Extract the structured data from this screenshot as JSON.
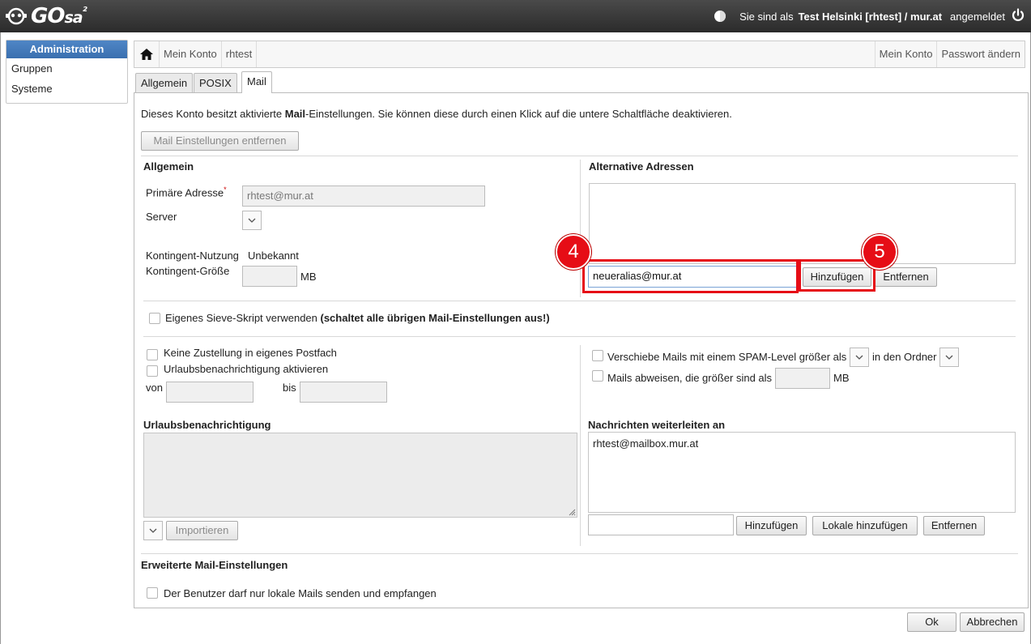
{
  "header": {
    "logo_text": "GO",
    "logo_sa": "sa",
    "logo_sup": "²",
    "user_prefix": "Sie sind als",
    "user_name": "Test Helsinki [rhtest] / mur.at",
    "user_suffix": "angemeldet"
  },
  "sidebar": {
    "title": "Administration",
    "items": [
      {
        "label": "Gruppen"
      },
      {
        "label": "Systeme"
      }
    ]
  },
  "breadcrumb": {
    "items": [
      "Mein Konto",
      "rhtest"
    ],
    "right": [
      "Mein Konto",
      "Passwort ändern"
    ]
  },
  "tabs": [
    {
      "label": "Allgemein"
    },
    {
      "label": "POSIX"
    },
    {
      "label": "Mail"
    }
  ],
  "mail": {
    "intro_before": "Dieses Konto besitzt aktivierte ",
    "intro_bold": "Mail",
    "intro_after": "-Einstellungen. Sie können diese durch einen Klick auf die untere Schaltfläche deaktivieren.",
    "remove_settings_button": "Mail Einstellungen entfernen",
    "general": {
      "title": "Allgemein",
      "primary_address_label": "Primäre Adresse",
      "required_mark": "*",
      "primary_address_value": "rhtest@mur.at",
      "server_label": "Server",
      "quota_usage_label": "Kontingent-Nutzung",
      "quota_usage_value": "Unbekannt",
      "quota_size_label": "Kontingent-Größe",
      "quota_unit": "MB"
    },
    "alternative": {
      "title": "Alternative Adressen",
      "input_value": "neueralias@mur.at",
      "add_button": "Hinzufügen",
      "remove_button": "Entfernen"
    },
    "sieve": {
      "label": "Eigenes Sieve-Skript verwenden ",
      "label_bold": "(schaltet alle übrigen Mail-Einstellungen aus!)"
    },
    "delivery": {
      "no_delivery_label": "Keine Zustellung in eigenes Postfach",
      "vacation_label": "Urlaubsbenachrichtigung aktivieren",
      "from_label": "von",
      "to_label": "bis"
    },
    "spam": {
      "move_label": "Verschiebe Mails mit einem SPAM-Level größer als",
      "folder_label": "in den Ordner",
      "reject_label": "Mails abweisen, die größer sind als",
      "reject_unit": "MB"
    },
    "vacation_message": {
      "title": "Urlaubsbenachrichtigung",
      "import_button": "Importieren"
    },
    "forward": {
      "title": "Nachrichten weiterleiten an",
      "entries": [
        "rhtest@mailbox.mur.at"
      ],
      "add_button": "Hinzufügen",
      "add_local_button": "Lokale hinzufügen",
      "remove_button": "Entfernen"
    },
    "advanced": {
      "title": "Erweiterte Mail-Einstellungen",
      "local_only_label": "Der Benutzer darf nur lokale Mails senden und empfangen"
    }
  },
  "annotations": {
    "marker_input": "4",
    "marker_add": "5",
    "color": "#e60d16"
  },
  "footer": {
    "ok_button": "Ok",
    "cancel_button": "Abbrechen"
  }
}
